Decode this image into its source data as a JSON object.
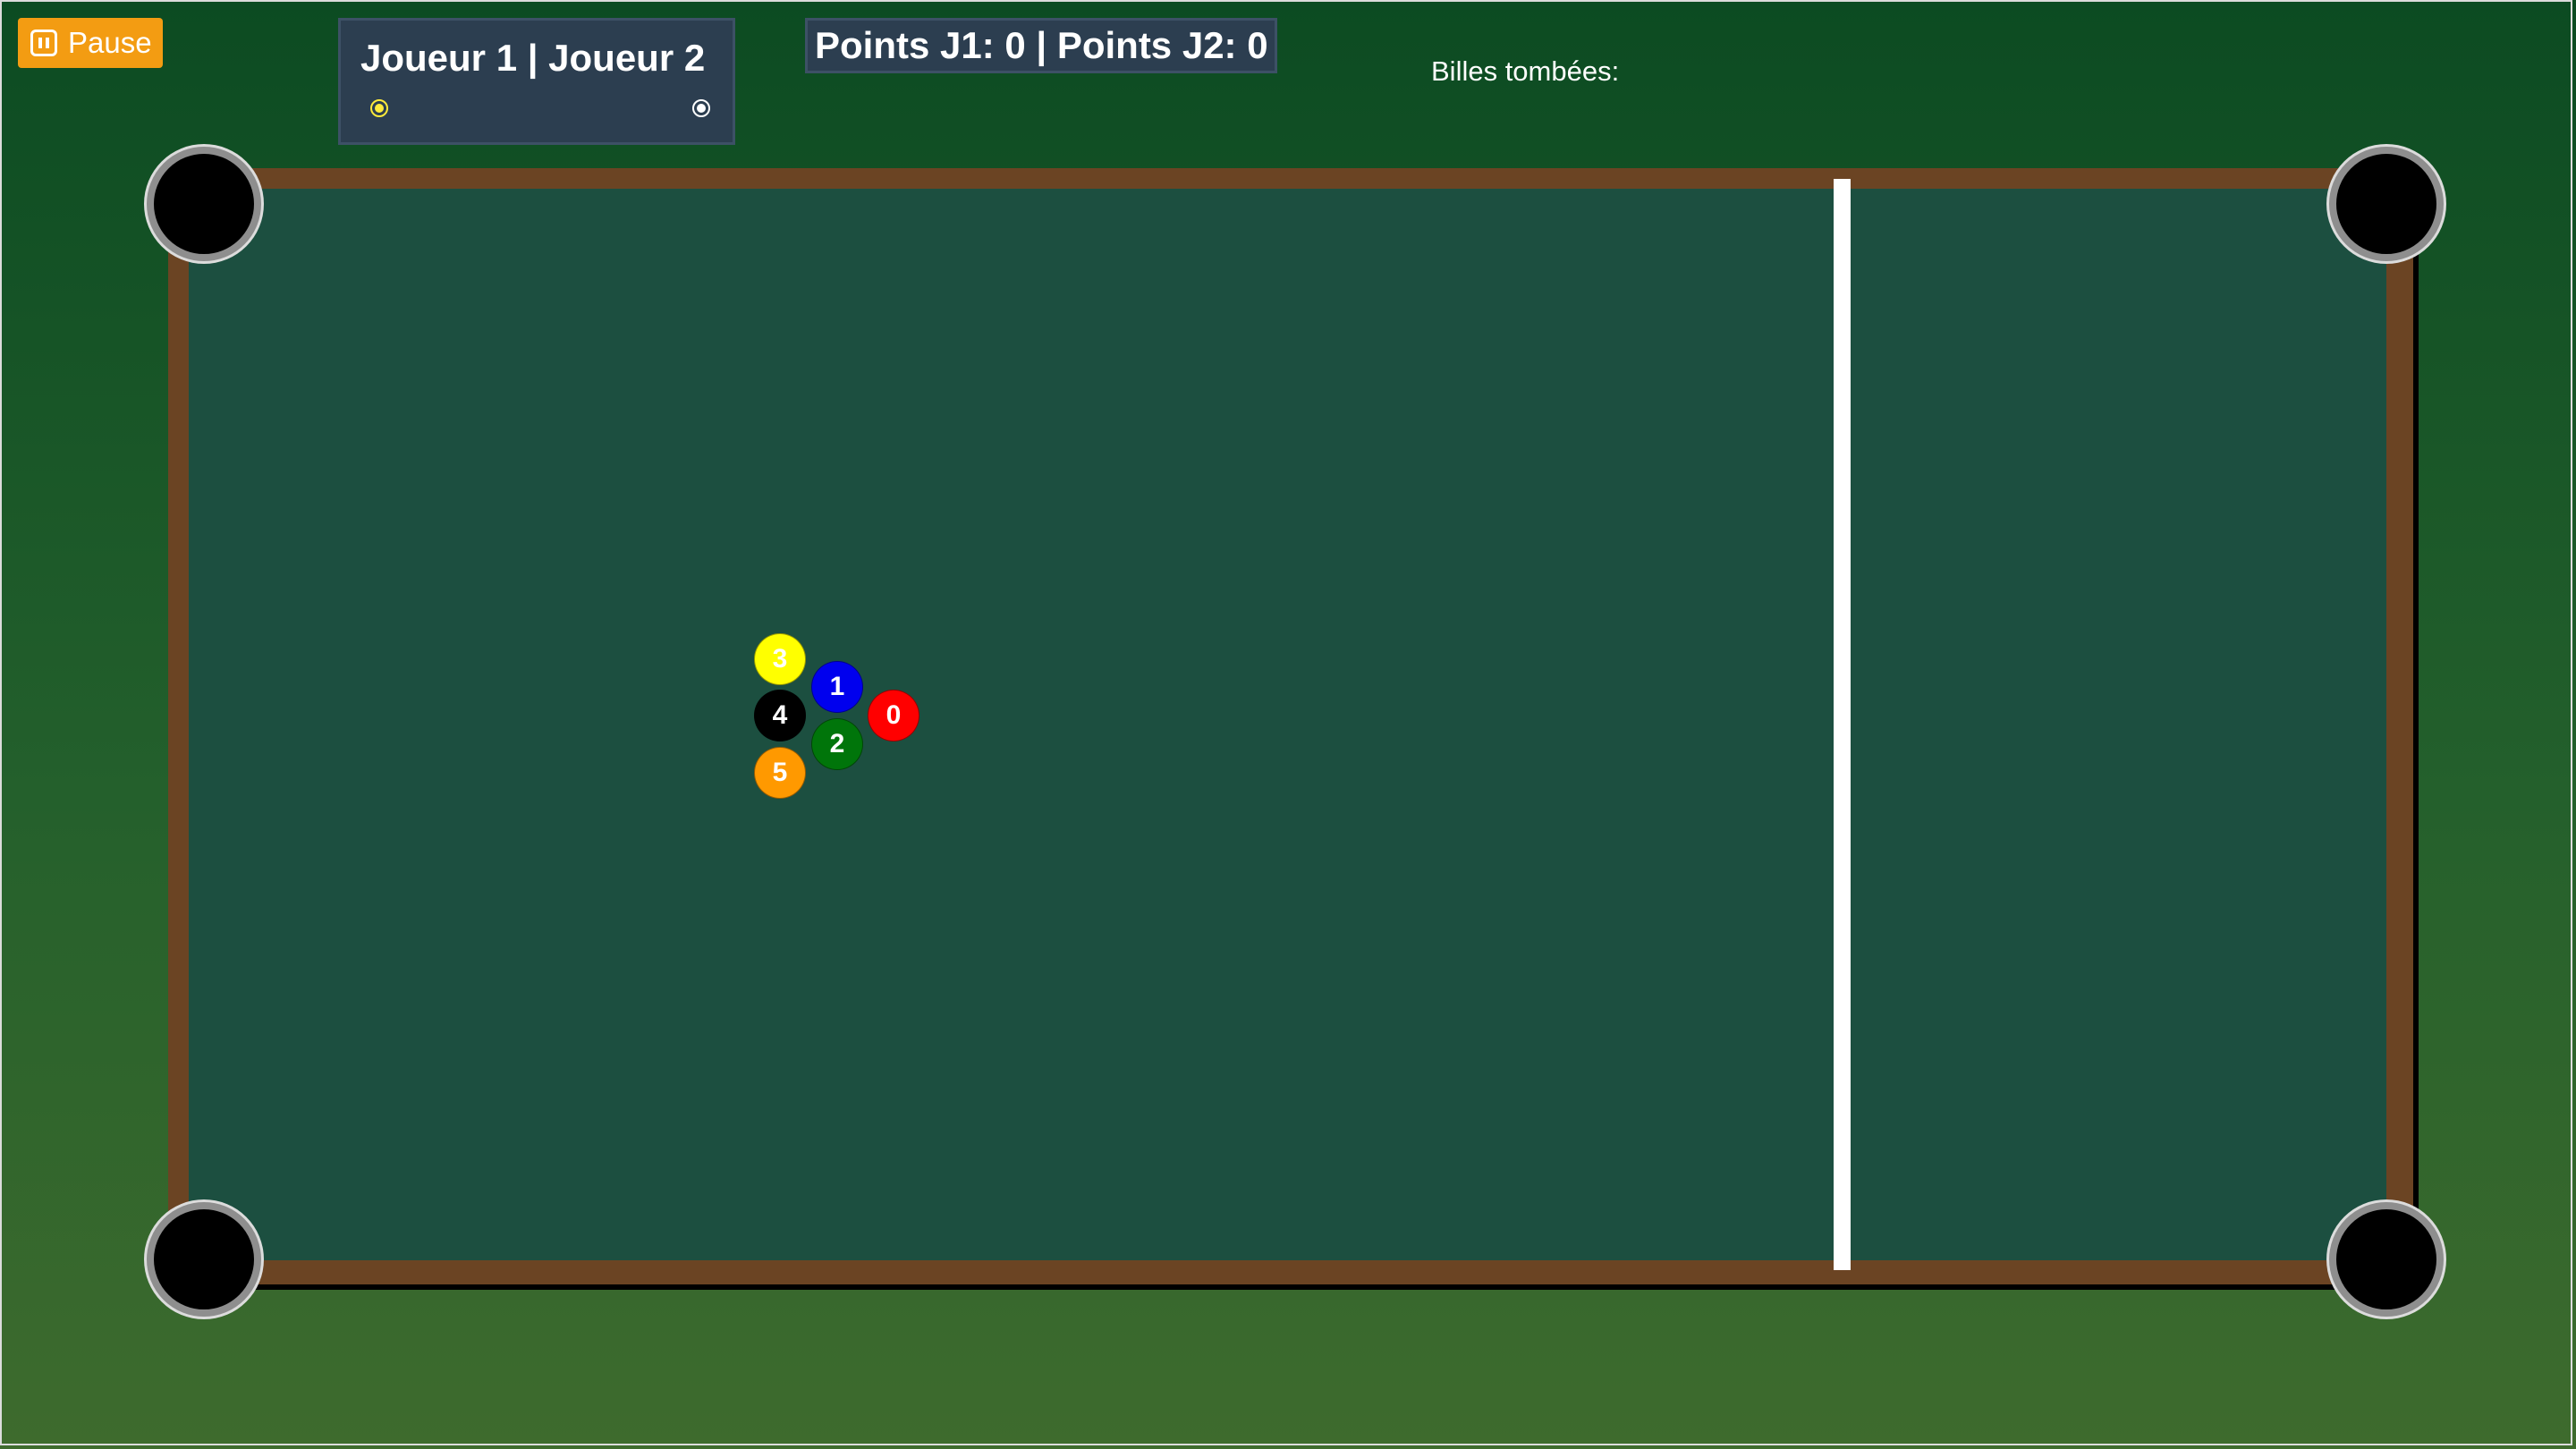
{
  "controls": {
    "pause_label": "Pause"
  },
  "players": {
    "title": "Joueur 1 | Joueur 2",
    "p1_color": "#ffeb3b",
    "p2_color": "#ffffff"
  },
  "score": {
    "text": "Points J1: 0 | Points J2: 0"
  },
  "fallen": {
    "label": "Billes tombées:"
  },
  "table": {
    "felt_color": "#1c4f40",
    "rail_color": "#6b4423"
  },
  "balls": [
    {
      "number": "0",
      "color": "#ff0000"
    },
    {
      "number": "1",
      "color": "#0000ee"
    },
    {
      "number": "2",
      "color": "#00750a"
    },
    {
      "number": "3",
      "color": "#ffff00"
    },
    {
      "number": "4",
      "color": "#000000"
    },
    {
      "number": "5",
      "color": "#ff9900"
    }
  ]
}
